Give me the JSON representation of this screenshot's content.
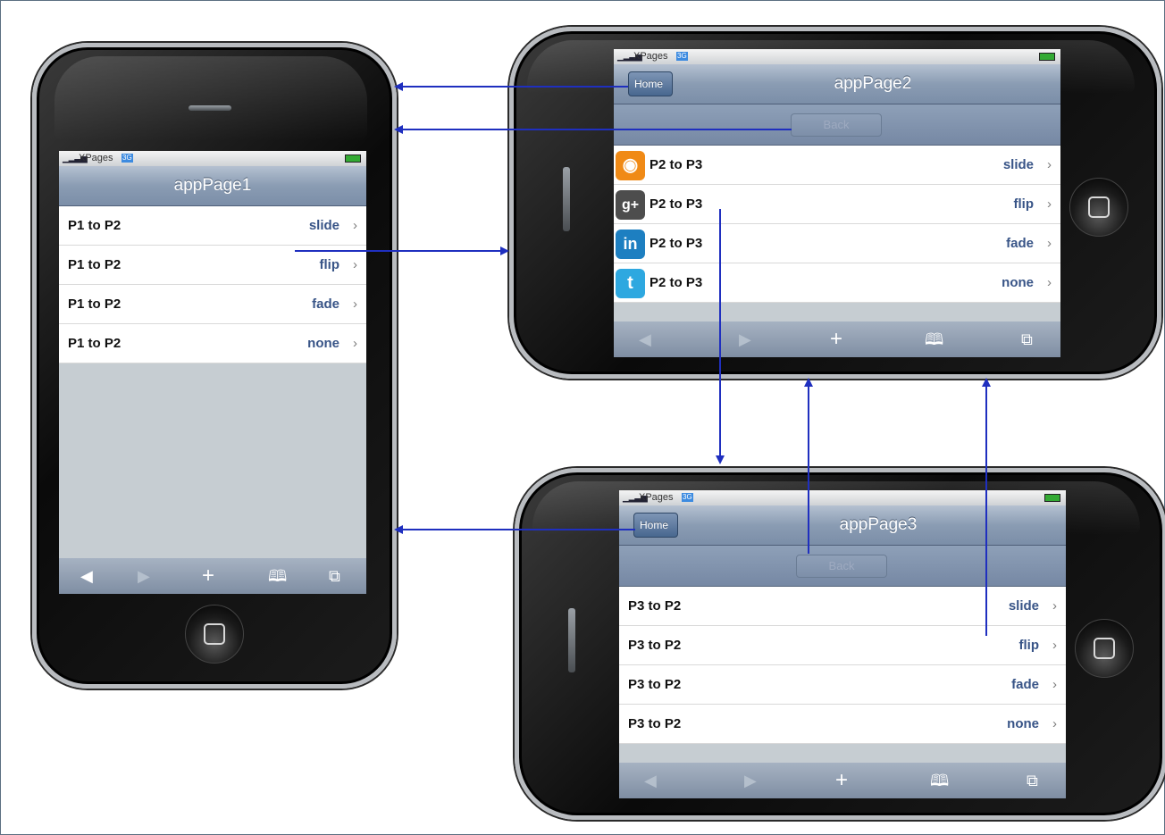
{
  "status": {
    "carrier": "XPages",
    "network": "3G"
  },
  "phones": {
    "page1": {
      "title": "appPage1",
      "rows": [
        {
          "label": "P1 to P2",
          "value": "slide"
        },
        {
          "label": "P1 to P2",
          "value": "flip"
        },
        {
          "label": "P1 to P2",
          "value": "fade"
        },
        {
          "label": "P1 to P2",
          "value": "none"
        }
      ]
    },
    "page2": {
      "title": "appPage2",
      "home_label": "Home",
      "back_label": "Back",
      "rows": [
        {
          "label": "P2 to P3",
          "value": "slide",
          "icon": "rss-icon"
        },
        {
          "label": "P2 to P3",
          "value": "flip",
          "icon": "google-plus-icon"
        },
        {
          "label": "P2 to P3",
          "value": "fade",
          "icon": "linkedin-icon"
        },
        {
          "label": "P2 to P3",
          "value": "none",
          "icon": "twitter-icon"
        }
      ]
    },
    "page3": {
      "title": "appPage3",
      "home_label": "Home",
      "back_label": "Back",
      "rows": [
        {
          "label": "P3 to P2",
          "value": "slide"
        },
        {
          "label": "P3 to P2",
          "value": "flip"
        },
        {
          "label": "P3 to P2",
          "value": "fade"
        },
        {
          "label": "P3 to P2",
          "value": "none"
        }
      ]
    }
  },
  "toolbar_icons": [
    "back-arrow-icon",
    "forward-arrow-icon",
    "plus-icon",
    "bookmarks-icon",
    "tabs-icon"
  ],
  "colors": {
    "arrow": "#1f2fbf",
    "nav_value": "#385487"
  }
}
